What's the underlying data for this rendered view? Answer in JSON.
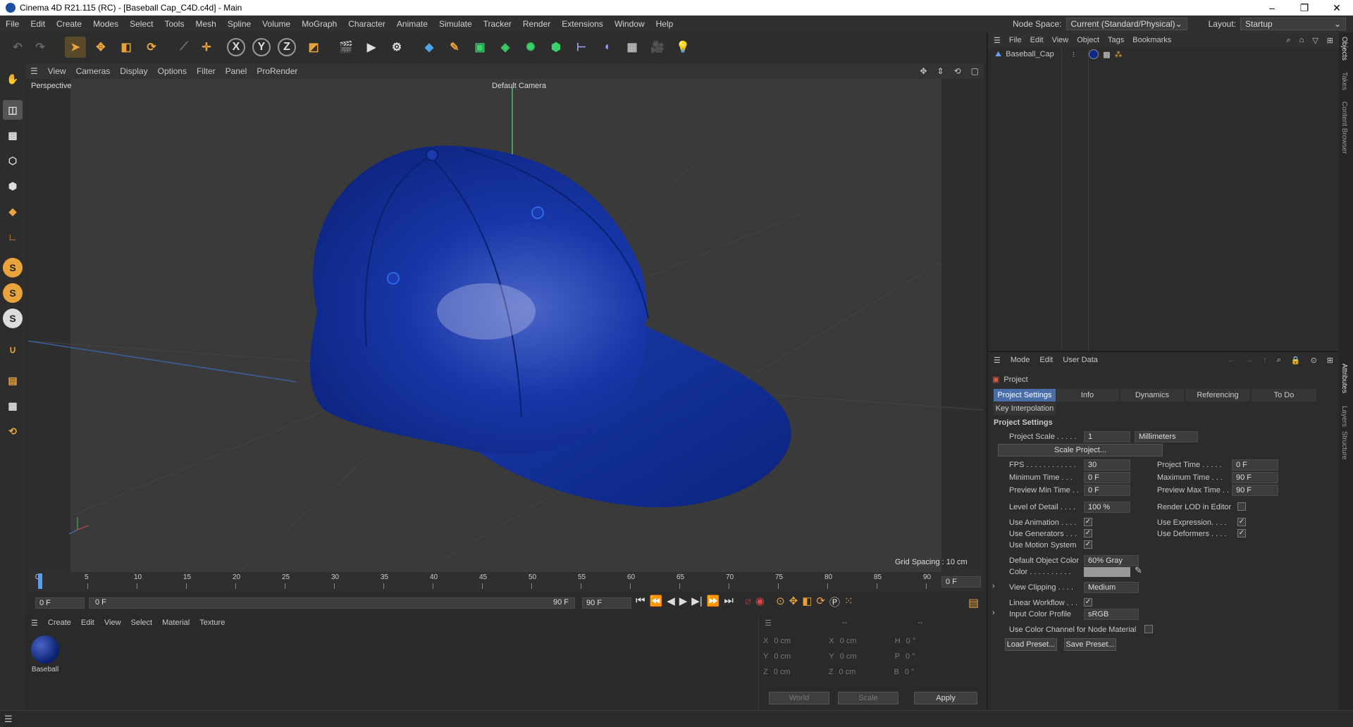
{
  "window": {
    "title": "Cinema 4D R21.115 (RC) - [Baseball Cap_C4D.c4d] - Main"
  },
  "menu": [
    "File",
    "Edit",
    "Create",
    "Modes",
    "Select",
    "Tools",
    "Mesh",
    "Spline",
    "Volume",
    "MoGraph",
    "Character",
    "Animate",
    "Simulate",
    "Tracker",
    "Render",
    "Extensions",
    "Window",
    "Help"
  ],
  "node_space": {
    "label": "Node Space:",
    "value": "Current (Standard/Physical)"
  },
  "layout": {
    "label": "Layout:",
    "value": "Startup"
  },
  "viewport": {
    "menu": [
      "View",
      "Cameras",
      "Display",
      "Options",
      "Filter",
      "Panel",
      "ProRender"
    ],
    "name": "Perspective",
    "camera": "Default Camera",
    "grid_spacing": "Grid Spacing : 10 cm"
  },
  "timeline": {
    "ticks": [
      "0",
      "5",
      "10",
      "15",
      "20",
      "25",
      "30",
      "35",
      "40",
      "45",
      "50",
      "55",
      "60",
      "65",
      "70",
      "75",
      "80",
      "85",
      "90"
    ],
    "current_frame": "0 F",
    "start": "0 F",
    "range_start": "0 F",
    "range_end": "90 F",
    "end": "90 F"
  },
  "material_manager": {
    "menu": [
      "Create",
      "Edit",
      "View",
      "Select",
      "Material",
      "Texture"
    ],
    "materials": [
      {
        "name": "Baseball"
      }
    ]
  },
  "coordinates": {
    "header": [
      "--",
      "--",
      "--"
    ],
    "rows": [
      {
        "a": "X",
        "av": "0 cm",
        "b": "X",
        "bv": "0 cm",
        "c": "H",
        "cv": "0 °"
      },
      {
        "a": "Y",
        "av": "0 cm",
        "b": "Y",
        "bv": "0 cm",
        "c": "P",
        "cv": "0 °"
      },
      {
        "a": "Z",
        "av": "0 cm",
        "b": "Z",
        "bv": "0 cm",
        "c": "B",
        "cv": "0 °"
      }
    ],
    "mode1": "World",
    "mode2": "Scale",
    "apply": "Apply"
  },
  "object_manager": {
    "menu": [
      "File",
      "Edit",
      "View",
      "Object",
      "Tags",
      "Bookmarks"
    ],
    "objects": [
      {
        "name": "Baseball_Cap"
      }
    ]
  },
  "attributes": {
    "menu": [
      "Mode",
      "Edit",
      "User Data"
    ],
    "title": "Project",
    "tabs": [
      "Project Settings",
      "Info",
      "Dynamics",
      "Referencing",
      "To Do"
    ],
    "tab2": "Key Interpolation",
    "section": "Project Settings",
    "project_scale": {
      "label": "Project Scale . . . . .",
      "value": "1",
      "unit": "Millimeters"
    },
    "scale_project": "Scale Project...",
    "fps": {
      "label": "FPS . . . . . . . . . . . .",
      "value": "30"
    },
    "project_time": {
      "label": "Project Time . . . . .",
      "value": "0 F"
    },
    "minimum_time": {
      "label": "Minimum Time . . .",
      "value": "0 F"
    },
    "maximum_time": {
      "label": "Maximum Time . . .",
      "value": "90 F"
    },
    "preview_min": {
      "label": "Preview Min Time . .",
      "value": "0 F"
    },
    "preview_max": {
      "label": "Preview Max Time . .",
      "value": "90 F"
    },
    "lod": {
      "label": "Level of Detail . . . .",
      "value": "100 %"
    },
    "render_lod": "Render LOD in Editor",
    "use_animation": "Use Animation . . . .",
    "use_expression": "Use Expression. . . .",
    "use_generators": "Use Generators . . .",
    "use_deformers": "Use Deformers . . . .",
    "use_motion": "Use Motion System",
    "default_color": {
      "label": "Default Object Color",
      "value": "60% Gray"
    },
    "color": "Color . . . . . . . . . .",
    "view_clipping": {
      "label": "View Clipping . . . .",
      "value": "Medium"
    },
    "linear_workflow": "Linear Workflow . . .",
    "input_profile": {
      "label": "Input Color Profile",
      "value": "sRGB"
    },
    "node_material": "Use Color Channel for Node Material",
    "load_preset": "Load Preset...",
    "save_preset": "Save Preset..."
  },
  "side_tabs": [
    "Objects",
    "Takes",
    "Content Browser",
    "Attributes",
    "Layers",
    "Structure"
  ],
  "colors": {
    "cap": "#0b2a8a",
    "accent": "#e8a33c"
  }
}
